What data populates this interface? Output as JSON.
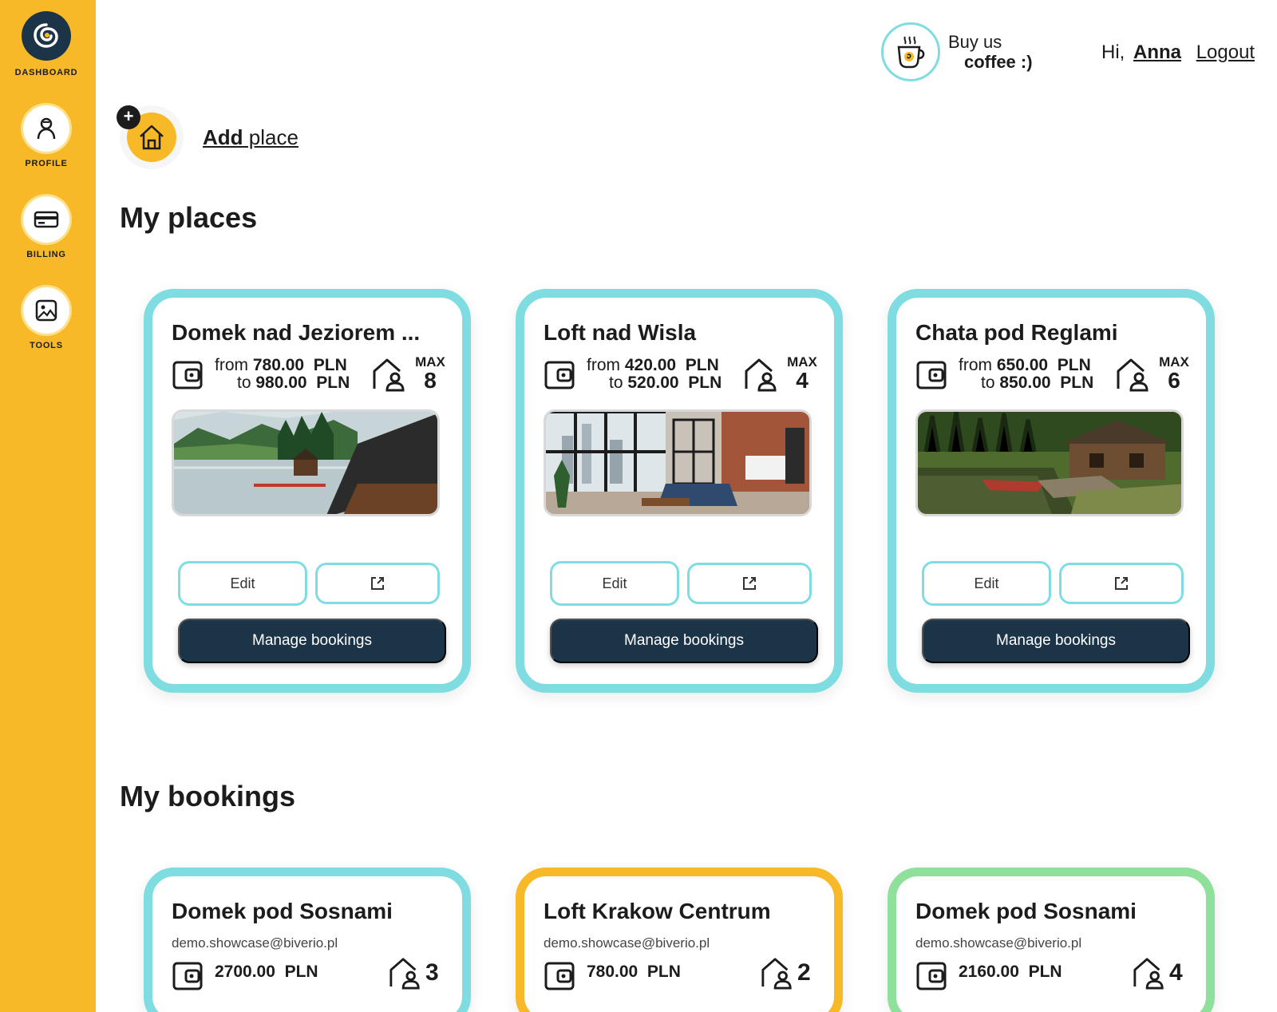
{
  "sidebar": {
    "items": [
      {
        "label": "DASHBOARD",
        "icon": "logo-icon"
      },
      {
        "label": "PROFILE",
        "icon": "user-icon"
      },
      {
        "label": "BILLING",
        "icon": "card-icon"
      },
      {
        "label": "TOOLS",
        "icon": "image-icon"
      }
    ]
  },
  "header": {
    "coffee_line1": "Buy us",
    "coffee_line2": "coffee :)",
    "greeting": "Hi,",
    "user_name": "Anna",
    "logout_label": "Logout"
  },
  "add_place": {
    "label_bold": "Add",
    "label_rest": " place"
  },
  "places_title": "My places",
  "places": [
    {
      "title": "Domek nad Jeziorem ...",
      "from_label": "from",
      "from_value": "780.00",
      "to_label": "to",
      "to_value": "980.00",
      "currency": "PLN",
      "max_label": "MAX",
      "max_value": "8",
      "edit_label": "Edit",
      "manage_label": "Manage bookings"
    },
    {
      "title": "Loft nad Wisla",
      "from_label": "from",
      "from_value": "420.00",
      "to_label": "to",
      "to_value": "520.00",
      "currency": "PLN",
      "max_label": "MAX",
      "max_value": "4",
      "edit_label": "Edit",
      "manage_label": "Manage bookings"
    },
    {
      "title": "Chata pod Reglami",
      "from_label": "from",
      "from_value": "650.00",
      "to_label": "to",
      "to_value": "850.00",
      "currency": "PLN",
      "max_label": "MAX",
      "max_value": "6",
      "edit_label": "Edit",
      "manage_label": "Manage bookings"
    }
  ],
  "bookings_title": "My bookings",
  "bookings": [
    {
      "title": "Domek pod Sosnami",
      "email": "demo.showcase@biverio.pl",
      "price": "2700.00",
      "currency": "PLN",
      "guests": "3"
    },
    {
      "title": "Loft Krakow Centrum",
      "email": "demo.showcase@biverio.pl",
      "price": "780.00",
      "currency": "PLN",
      "guests": "2"
    },
    {
      "title": "Domek pod Sosnami",
      "email": "demo.showcase@biverio.pl",
      "price": "2160.00",
      "currency": "PLN",
      "guests": "4"
    }
  ],
  "colors": {
    "sidebar": "#f7b928",
    "accent_teal": "#7fdde2",
    "dark_navy": "#1b3448",
    "booking_orange": "#f7b928",
    "booking_green": "#8ee09a"
  }
}
